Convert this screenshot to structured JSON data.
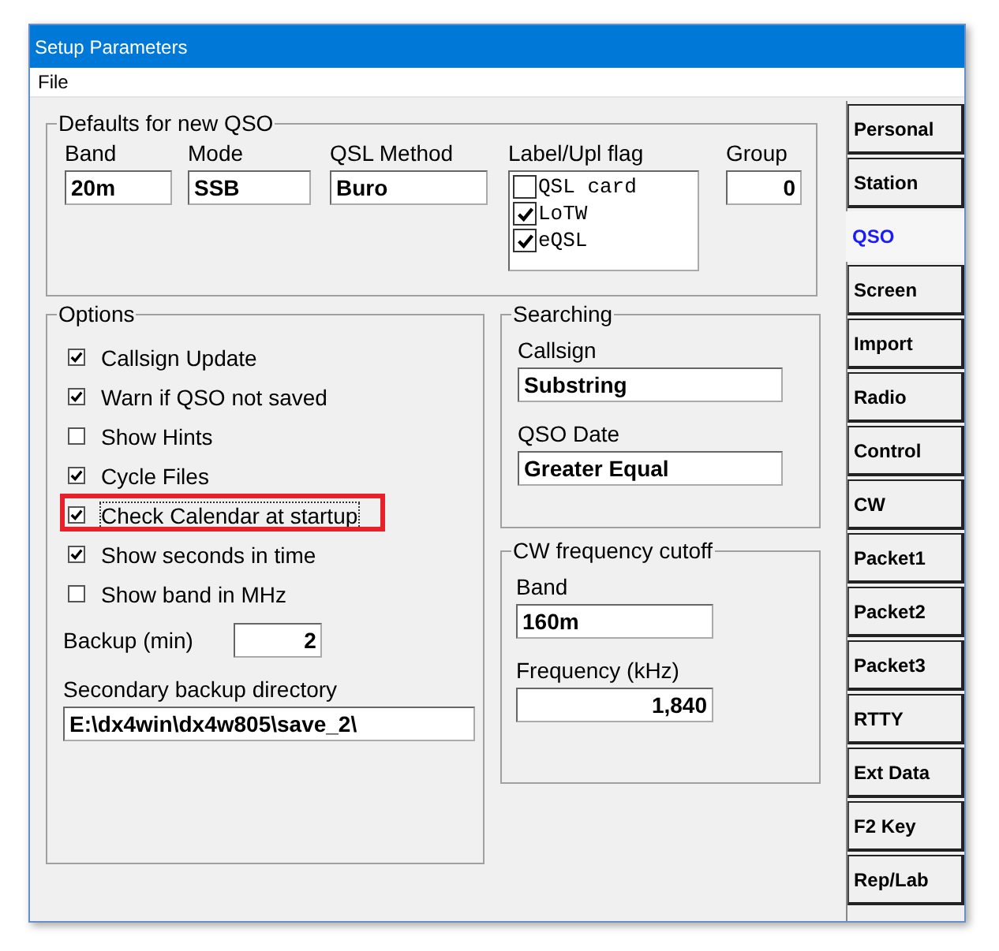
{
  "window": {
    "title": "Setup Parameters"
  },
  "menu": [
    {
      "label": "File"
    }
  ],
  "defaults": {
    "title": "Defaults for new QSO",
    "fields": [
      {
        "label": "Band",
        "value": "20m"
      },
      {
        "label": "Mode",
        "value": "SSB"
      },
      {
        "label": "QSL Method",
        "value": "Buro"
      }
    ],
    "flags": {
      "label": "Label/Upl flag",
      "items": [
        {
          "label": "QSL card",
          "checked": false
        },
        {
          "label": "LoTW",
          "checked": true
        },
        {
          "label": "eQSL",
          "checked": true
        }
      ]
    },
    "group": {
      "label": "Group",
      "value": "0"
    }
  },
  "options": {
    "title": "Options",
    "items": [
      {
        "label": "Callsign Update",
        "checked": true,
        "highlighted": false
      },
      {
        "label": "Warn if QSO not saved",
        "checked": true,
        "highlighted": false
      },
      {
        "label": "Show Hints",
        "checked": false,
        "highlighted": false
      },
      {
        "label": "Cycle Files",
        "checked": true,
        "highlighted": false
      },
      {
        "label": "Check Calendar at startup",
        "checked": true,
        "highlighted": true
      },
      {
        "label": "Show seconds in time",
        "checked": true,
        "highlighted": false
      },
      {
        "label": "Show band in MHz",
        "checked": false,
        "highlighted": false
      }
    ],
    "backup": {
      "label": "Backup (min)",
      "value": "2"
    },
    "secondary": {
      "label": "Secondary backup directory",
      "value": "E:\\dx4win\\dx4w805\\save_2\\"
    }
  },
  "searching": {
    "title": "Searching",
    "fields": [
      {
        "label": "Callsign",
        "value": "Substring"
      },
      {
        "label": "QSO Date",
        "value": "Greater Equal"
      }
    ]
  },
  "cw_cutoff": {
    "title": "CW frequency cutoff",
    "fields": [
      {
        "label": "Band",
        "value": "160m",
        "kind": "text"
      },
      {
        "label": "Frequency (kHz)",
        "value": "1,840",
        "kind": "number"
      }
    ]
  },
  "tabs": [
    {
      "label": "Personal",
      "selected": false
    },
    {
      "label": "Station",
      "selected": false
    },
    {
      "label": "QSO",
      "selected": true
    },
    {
      "label": "Screen",
      "selected": false
    },
    {
      "label": "Import",
      "selected": false
    },
    {
      "label": "Radio",
      "selected": false
    },
    {
      "label": "Control",
      "selected": false
    },
    {
      "label": "CW",
      "selected": false
    },
    {
      "label": "Packet1",
      "selected": false
    },
    {
      "label": "Packet2",
      "selected": false
    },
    {
      "label": "Packet3",
      "selected": false
    },
    {
      "label": "RTTY",
      "selected": false
    },
    {
      "label": "Ext Data",
      "selected": false
    },
    {
      "label": "F2 Key",
      "selected": false
    },
    {
      "label": "Rep/Lab",
      "selected": false
    }
  ]
}
